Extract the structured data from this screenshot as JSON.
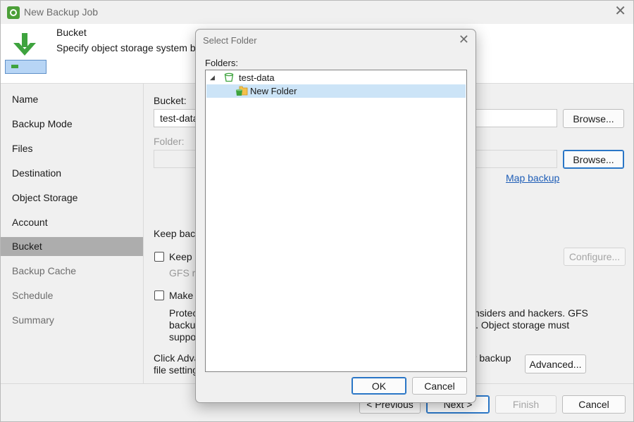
{
  "window": {
    "title": "New Backup Job"
  },
  "header": {
    "title": "Bucket",
    "subtitle": "Specify object storage system bucket"
  },
  "sidebar": {
    "items": [
      {
        "label": "Name",
        "state": "normal"
      },
      {
        "label": "Backup Mode",
        "state": "normal"
      },
      {
        "label": "Files",
        "state": "normal"
      },
      {
        "label": "Destination",
        "state": "normal"
      },
      {
        "label": "Object Storage",
        "state": "normal"
      },
      {
        "label": "Account",
        "state": "normal"
      },
      {
        "label": "Bucket",
        "state": "active"
      },
      {
        "label": "Backup Cache",
        "state": "disabled"
      },
      {
        "label": "Schedule",
        "state": "disabled"
      },
      {
        "label": "Summary",
        "state": "disabled"
      }
    ]
  },
  "main": {
    "bucket_label": "Bucket:",
    "bucket_value": "test-data",
    "browse_label": "Browse...",
    "folder_label": "Folder:",
    "folder_value": "",
    "browse2_label": "Browse...",
    "map_backup_label": "Map backup",
    "keep_backups_label": "Keep back",
    "keep_checkbox_label": "Keep c",
    "gfs_label": "GFS re",
    "configure_label": "Configure...",
    "make_checkbox_label": "Make",
    "protect_line1": "Protec",
    "protect_line2": "backu",
    "protect_line3": "suppo",
    "protect_right1": "s insiders and hackers. GFS",
    "protect_right2": "icy. Object storage must",
    "advanced_text1": "Click Adva",
    "advanced_text2": "file setting",
    "advanced_right": "er backup",
    "advanced_label": "Advanced..."
  },
  "footer": {
    "previous_label": "< Previous",
    "next_label": "Next >",
    "finish_label": "Finish",
    "cancel_label": "Cancel"
  },
  "dialog": {
    "title": "Select Folder",
    "folders_label": "Folders:",
    "tree": [
      {
        "label": "test-data",
        "type": "bucket",
        "expanded": true
      },
      {
        "label": "New Folder",
        "type": "folder",
        "selected": true
      }
    ],
    "ok_label": "OK",
    "cancel_label": "Cancel"
  },
  "colors": {
    "accent": "#2a76c6",
    "link": "#1f5eb7",
    "sidebar_active": "#adadad",
    "tree_selected": "#cce4f7",
    "brand_green": "#4c9f38"
  },
  "icons": [
    "app-gear-icon",
    "close-icon",
    "download-arrow-icon",
    "disk-icon",
    "expander-icon",
    "bucket-icon",
    "folder-icon"
  ]
}
